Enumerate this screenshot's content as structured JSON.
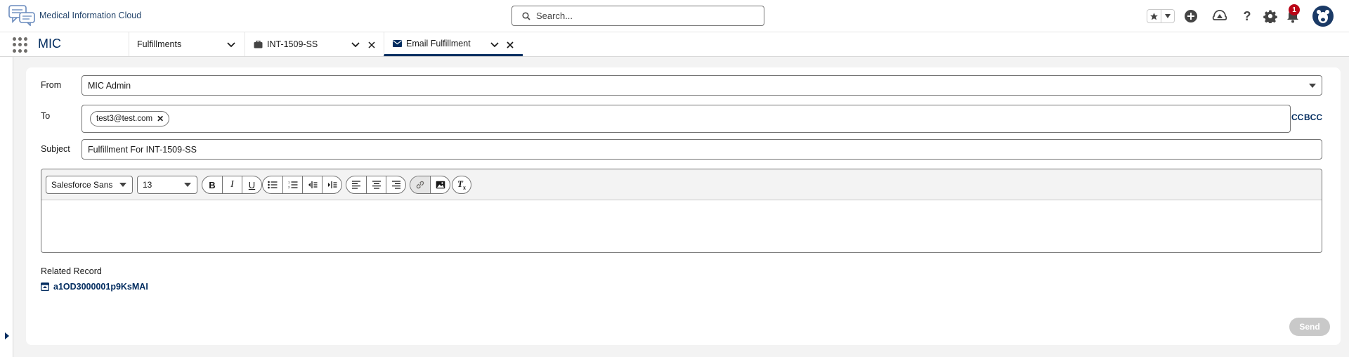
{
  "header": {
    "logo_text": "Medical Information Cloud",
    "search_placeholder": "Search...",
    "notification_count": "1"
  },
  "nav": {
    "app_name": "MIC",
    "tabs": [
      {
        "label": "Fulfillments"
      },
      {
        "label": "INT-1509-SS"
      },
      {
        "label": "Email Fulfillment"
      }
    ]
  },
  "form": {
    "from_label": "From",
    "from_value": "MIC Admin",
    "to_label": "To",
    "to_recipients": [
      "test3@test.com"
    ],
    "cc_label": "CC",
    "bcc_label": "BCC",
    "subject_label": "Subject",
    "subject_value": "Fulfillment For INT-1509-SS",
    "editor": {
      "font_family": "Salesforce Sans",
      "font_size": "13",
      "body": ""
    },
    "related_record_label": "Related Record",
    "related_record_value": "a1OD3000001p9KsMAI",
    "send_label": "Send"
  },
  "colors": {
    "brand_navy": "#032d60",
    "notification_red": "#ba0517",
    "disabled_button": "#c9c9c9"
  }
}
